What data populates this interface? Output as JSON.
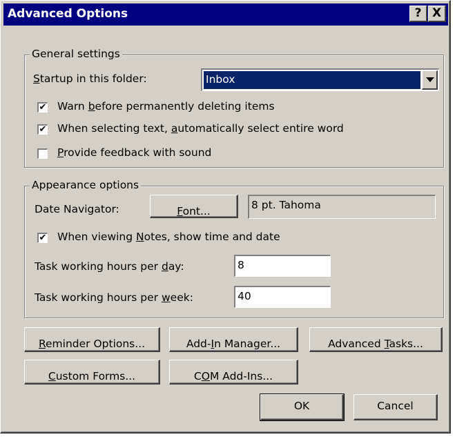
{
  "dialog": {
    "title": "Advanced Options",
    "help_glyph": "?",
    "close_glyph": "X"
  },
  "general": {
    "legend": "General settings",
    "startup_label_accel": "S",
    "startup_label_rest": "tartup in this folder:",
    "startup_value": "Inbox",
    "options": [
      {
        "pre": "Warn ",
        "accel": "b",
        "post": "efore permanently deleting items",
        "checked": true
      },
      {
        "pre": "When selecting text, ",
        "accel": "a",
        "post": "utomatically select entire word",
        "checked": true
      },
      {
        "pre": "",
        "accel": "P",
        "post": "rovide feedback with sound",
        "checked": false
      }
    ]
  },
  "appearance": {
    "legend": "Appearance options",
    "date_nav_label": "Date Navigator:",
    "font_button_accel": "F",
    "font_button_rest": "ont...",
    "font_value": "8 pt. Tahoma",
    "notes_pre": "When viewing ",
    "notes_accel": "N",
    "notes_post": "otes, show time and date",
    "notes_checked": true,
    "hours_day_pre": "Task working hours per ",
    "hours_day_accel": "d",
    "hours_day_post": "ay:",
    "hours_day_value": "8",
    "hours_week_pre": "Task working hours per ",
    "hours_week_accel": "w",
    "hours_week_post": "eek:",
    "hours_week_value": "40"
  },
  "buttons": {
    "reminder_accel": "R",
    "reminder_rest": "eminder Options...",
    "addin_pre": "Add-",
    "addin_accel": "I",
    "addin_post": "n Manager...",
    "advanced_pre": "Advanced ",
    "advanced_accel": "T",
    "advanced_post": "asks...",
    "custom_accel": "C",
    "custom_rest": "ustom Forms...",
    "com_pre": "C",
    "com_accel": "O",
    "com_post": "M Add-Ins...",
    "ok": "OK",
    "cancel": "Cancel"
  }
}
